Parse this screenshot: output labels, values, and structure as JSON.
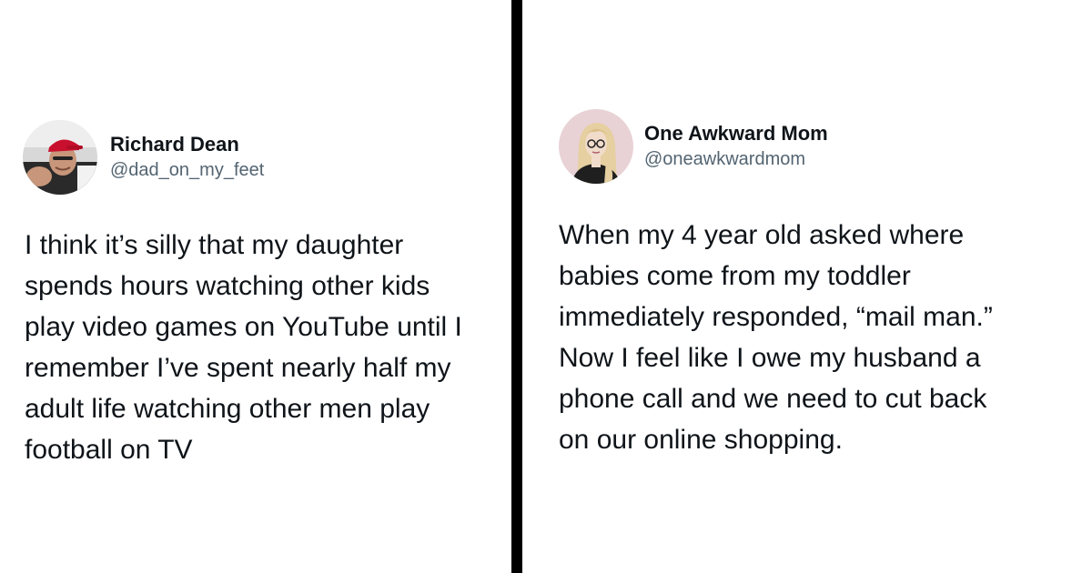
{
  "tweets": [
    {
      "display_name": "Richard Dean",
      "handle": "@dad_on_my_feet",
      "text": "I think it’s silly that my daughter\nspends hours watching other kids\nplay video games on YouTube until I\nremember I’ve spent nearly half my\nadult life watching other men play\nfootball on TV"
    },
    {
      "display_name": "One Awkward Mom",
      "handle": "@oneawkwardmom",
      "text": "When my 4 year old asked where\nbabies come from my toddler\nimmediately responded, “mail man.”\nNow I feel like I owe my husband a\nphone call and we need to cut back\non our online shopping."
    }
  ],
  "colors": {
    "text_primary": "#0f1419",
    "text_secondary": "#536471",
    "divider": "#000000",
    "background": "#ffffff"
  }
}
